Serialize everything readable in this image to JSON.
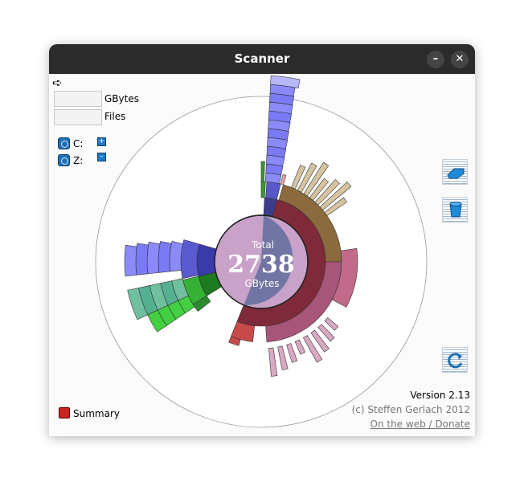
{
  "window": {
    "title": "Scanner"
  },
  "controls": {
    "minimize": "–",
    "close": "✕"
  },
  "menu": {
    "arrow": "➪"
  },
  "stats": {
    "size_value": "",
    "size_unit": "GBytes",
    "files_value": "",
    "files_unit": "Files"
  },
  "drives": [
    {
      "label": "C:",
      "button": "+"
    },
    {
      "label": "Z:",
      "button": "–"
    }
  ],
  "center": {
    "label": "Total",
    "value": "2738",
    "unit": "GBytes"
  },
  "footer": {
    "summary": "Summary",
    "version": "Version 2.13",
    "copyright": "(c) Steffen Gerlach 2012",
    "link": "On the web / Donate"
  },
  "icons": {
    "tools": [
      "eraser-icon",
      "trash-bin-icon",
      "refresh-icon"
    ],
    "window": [
      "minimize-icon",
      "close-icon"
    ]
  },
  "colors": {
    "titlebar": "#2b2b2b",
    "center_fill": "#c8a2c8",
    "center_overlay": "#5a6a9a",
    "red_ring": "#7f2a3a",
    "brown_ring": "#8b6a3e",
    "pink_ring": "#a8557a",
    "blue": "#7070f0",
    "green": "#2ea02e",
    "teal": "#55b092"
  }
}
